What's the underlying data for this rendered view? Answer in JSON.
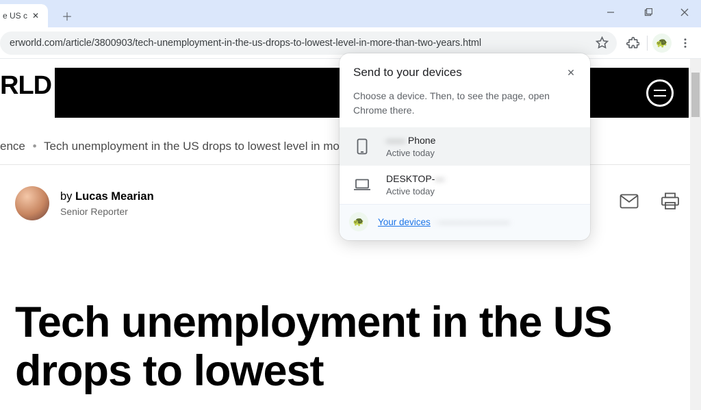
{
  "browser": {
    "tab_title": "e US c",
    "url": "erworld.com/article/3800903/tech-unemployment-in-the-us-drops-to-lowest-level-in-more-than-two-years.html"
  },
  "popup": {
    "title": "Send to your devices",
    "description": "Choose a device. Then, to see the page, open Chrome there.",
    "devices": [
      {
        "name_prefix": "——",
        "name_suffix": " Phone",
        "status": "Active today"
      },
      {
        "name_prefix": "DESKTOP-",
        "name_suffix": "—",
        "status": "Active today"
      }
    ],
    "footer_link": "Your devices",
    "footer_extra": " · ————————"
  },
  "page": {
    "brand_fragment": "RLD",
    "breadcrumb_a": "ence",
    "breadcrumb_b": "Tech unemployment in the US drops to lowest level in mor",
    "by_label": "by ",
    "author_name": "Lucas Mearian",
    "author_role": "Senior Reporter",
    "headline": "Tech unemployment in the US drops to lowest"
  }
}
